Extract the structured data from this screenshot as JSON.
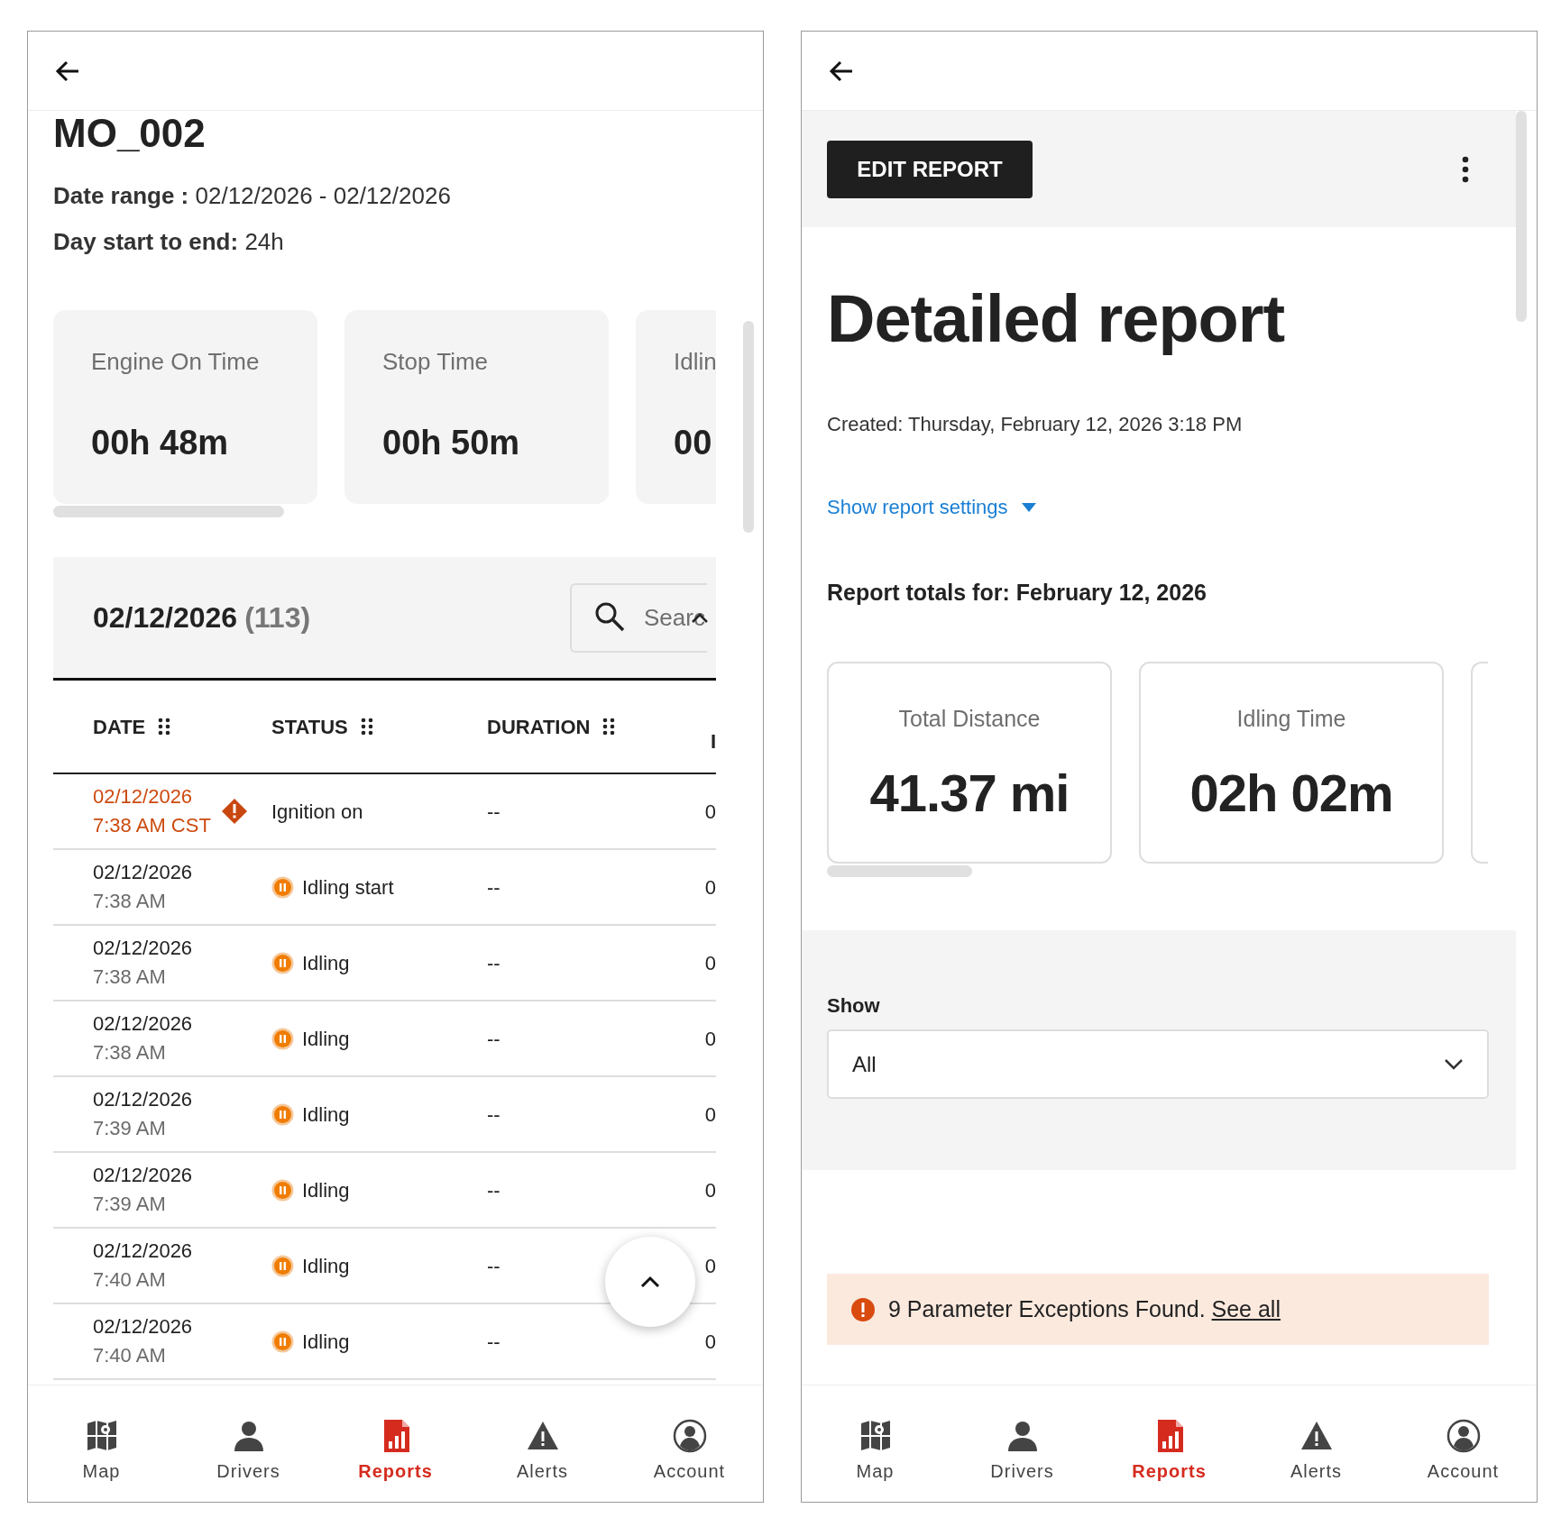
{
  "left": {
    "title": "MO_002",
    "date_range": "**Date range :** 02/12/2026 - 02/12/2026",
    "day_span": "**Day start to end:** 24h",
    "cards": [
      {
        "label": "Engine On Time",
        "value": "00h 48m"
      },
      {
        "label": "Stop Time",
        "value": "00h 50m"
      },
      {
        "label": "Idlin",
        "value": "00"
      }
    ],
    "table": {
      "date": "02/12/2026",
      "count": "(113)",
      "search": {
        "placeholder": "Searc"
      },
      "columns": [
        {
          "label": "DATE",
          "handle": true
        },
        {
          "label": "STATUS",
          "handle": true
        },
        {
          "label": "DURATION",
          "handle": true
        },
        {
          "label": "I",
          "handle": false
        }
      ],
      "rows": [
        {
          "date": "02/12/2026",
          "time": "7:38 AM CST",
          "exception": true,
          "kind": "ignition",
          "status": "Ignition on",
          "duration": "--",
          "column_4": "0"
        },
        {
          "date": "02/12/2026",
          "time": "7:38 AM",
          "exception": false,
          "kind": "idling",
          "status": "Idling start",
          "duration": "--",
          "column_4": "0"
        },
        {
          "date": "02/12/2026",
          "time": "7:38 AM",
          "exception": false,
          "kind": "idling",
          "status": "Idling",
          "duration": "--",
          "column_4": "0"
        },
        {
          "date": "02/12/2026",
          "time": "7:38 AM",
          "exception": false,
          "kind": "idling",
          "status": "Idling",
          "duration": "--",
          "column_4": "0"
        },
        {
          "date": "02/12/2026",
          "time": "7:39 AM",
          "exception": false,
          "kind": "idling",
          "status": "Idling",
          "duration": "--",
          "column_4": "0"
        },
        {
          "date": "02/12/2026",
          "time": "7:39 AM",
          "exception": false,
          "kind": "idling",
          "status": "Idling",
          "duration": "--",
          "column_4": "0"
        },
        {
          "date": "02/12/2026",
          "time": "7:40 AM",
          "exception": false,
          "kind": "idling",
          "status": "Idling",
          "duration": "--",
          "column_4": "0"
        },
        {
          "date": "02/12/2026",
          "time": "7:40 AM",
          "exception": false,
          "kind": "idling",
          "status": "Idling",
          "duration": "--",
          "column_4": "0"
        }
      ]
    },
    "nav": [
      {
        "kind": "map",
        "label": "Map",
        "selected": false
      },
      {
        "kind": "drivers",
        "label": "Drivers",
        "selected": false
      },
      {
        "kind": "reports",
        "label": "Reports",
        "selected": true
      },
      {
        "kind": "alerts",
        "label": "Alerts",
        "selected": false
      },
      {
        "kind": "account",
        "label": "Account",
        "selected": false
      }
    ]
  },
  "right": {
    "edit_button": "EDIT REPORT",
    "title": "Detailed report",
    "created": "Created: Thursday, February 12, 2026 3:18 PM",
    "settings_link": "Show report settings",
    "totals_heading": "Report totals for: February 12, 2026",
    "cards": [
      {
        "label": "Total Distance",
        "value": "41.37 mi"
      },
      {
        "label": "Idling Time",
        "value": "02h 02m"
      }
    ],
    "show": {
      "label": "Show",
      "value": "All"
    },
    "exceptions": {
      "message": "9 Parameter Exceptions Found.",
      "link": "See all"
    },
    "nav": [
      {
        "kind": "map",
        "label": "Map",
        "selected": false
      },
      {
        "kind": "drivers",
        "label": "Drivers",
        "selected": false
      },
      {
        "kind": "reports",
        "label": "Reports",
        "selected": true
      },
      {
        "kind": "alerts",
        "label": "Alerts",
        "selected": false
      },
      {
        "kind": "account",
        "label": "Account",
        "selected": false
      }
    ]
  }
}
